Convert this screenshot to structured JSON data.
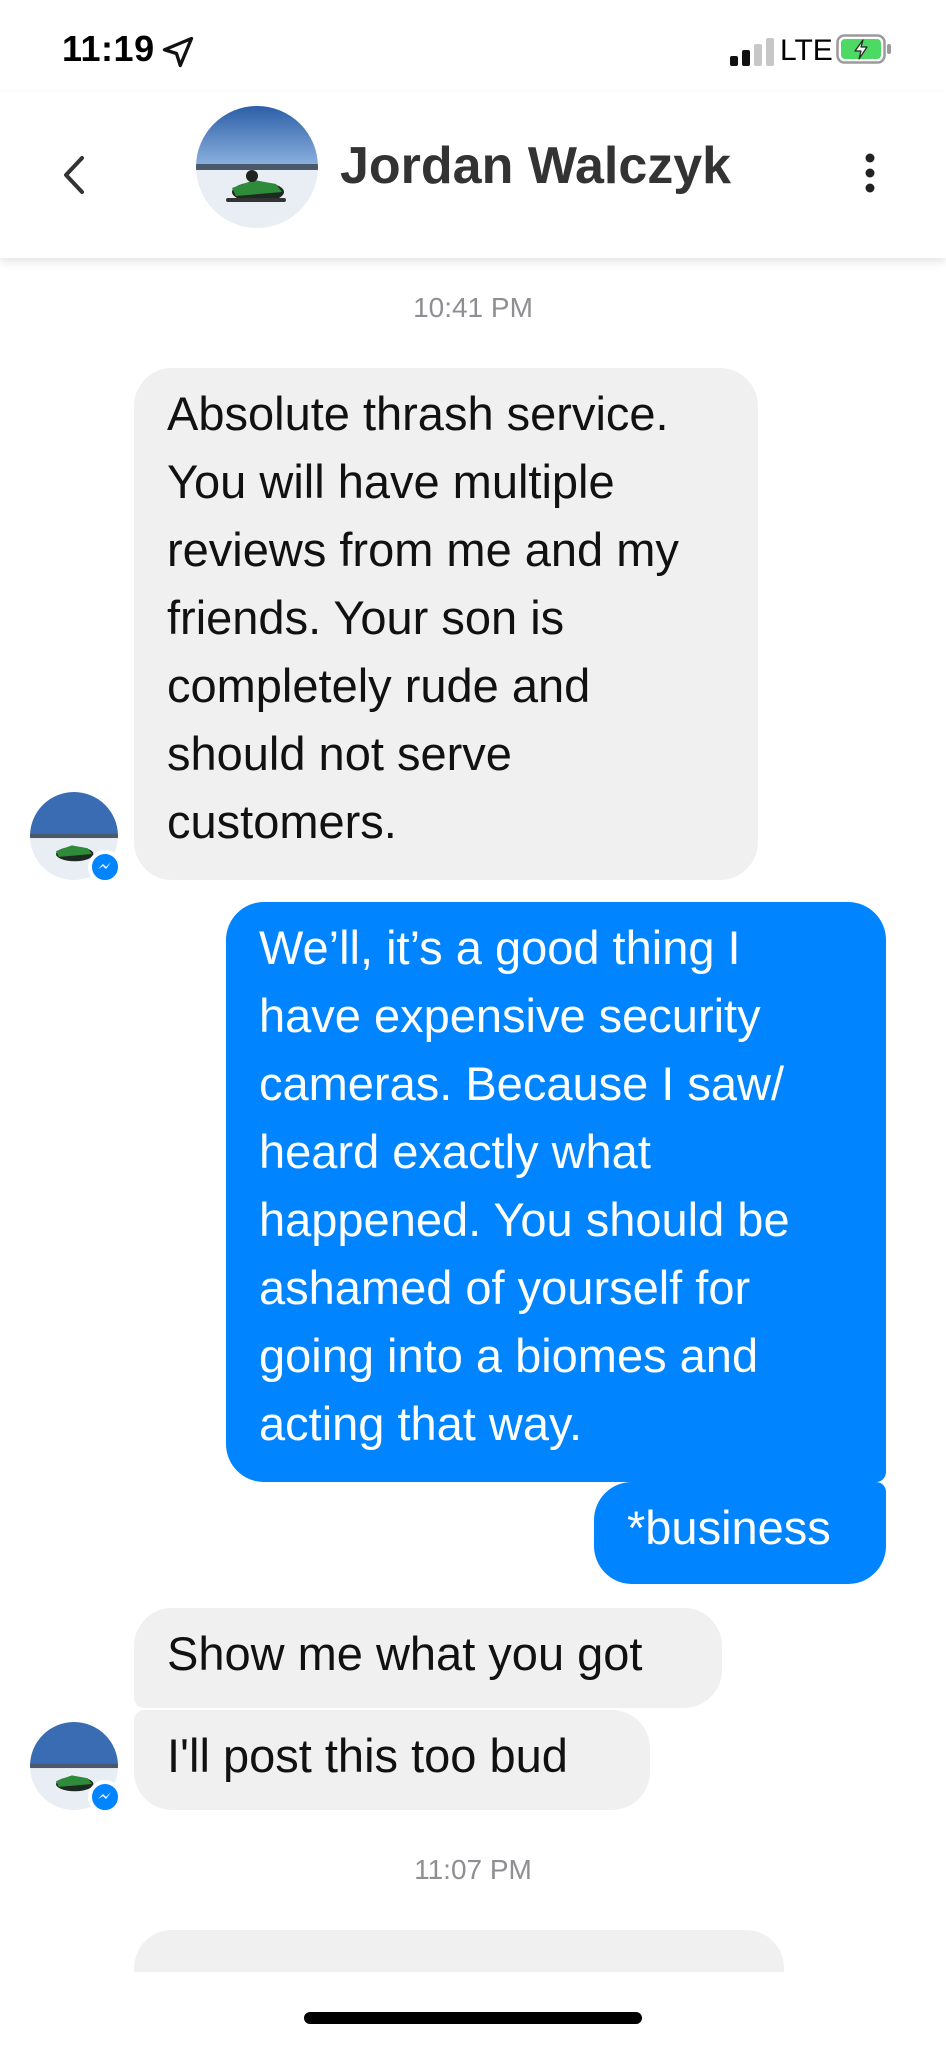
{
  "status_bar": {
    "time": "11:19",
    "network": "LTE",
    "location_icon": "location-arrow-icon",
    "signal_icon": "cellular-signal-icon",
    "battery_icon": "battery-charging-icon",
    "signal_bars_active": 2,
    "signal_bars_total": 4,
    "battery_color": "#4cd964"
  },
  "header": {
    "contact_name": "Jordan Walczyk",
    "back_icon": "chevron-left-icon",
    "more_icon": "more-vertical-icon",
    "avatar_icon": "profile-photo-snowmobile"
  },
  "colors": {
    "outgoing_bubble": "#0084ff",
    "incoming_bubble": "#f0f0f0",
    "timestamp": "#8e8e93"
  },
  "conversation": {
    "timestamp_1": "10:41 PM",
    "msg_1": "Absolute thrash service.\nYou will have multiple\nreviews from me and my\nfriends. Your son is\ncompletely rude and\nshould not serve\ncustomers.",
    "msg_2": "We’ll, it’s a good thing I\nhave expensive security\ncameras.  Because I saw/\nheard exactly what\nhappened.  You should be\nashamed of yourself for\ngoing into a biomes and\nacting that way.",
    "msg_3": "*business",
    "msg_4": "Show me what you got",
    "msg_5": "I'll post this too bud",
    "timestamp_2": "11:07 PM"
  }
}
